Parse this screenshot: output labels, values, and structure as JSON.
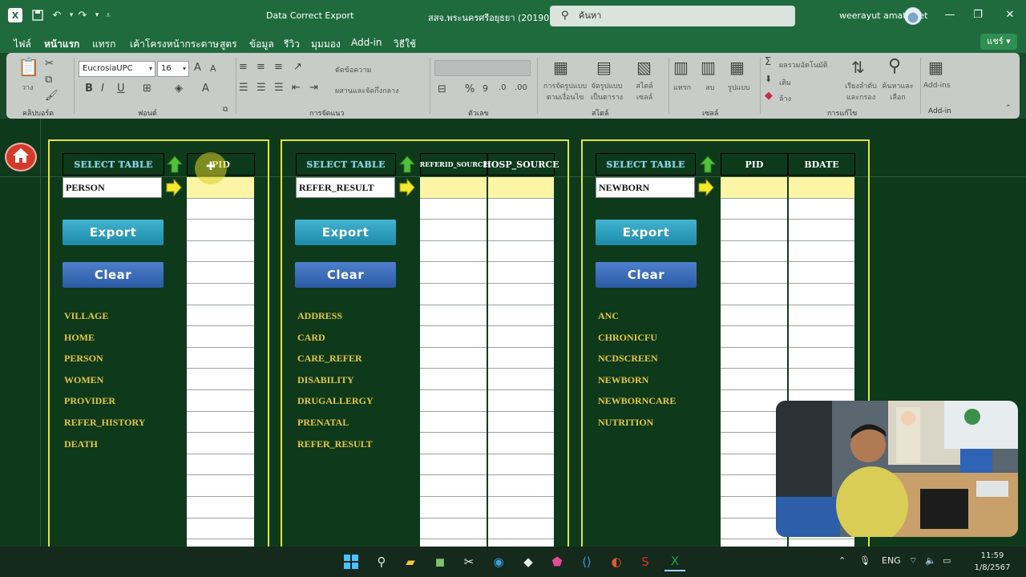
{
  "titlebar": {
    "app_title": "Data Correct Export",
    "file_title": "สสจ.พระนครศรีอยุธยา (20190...",
    "search_placeholder": "ค้นหา",
    "user_name": "weerayut amatawet"
  },
  "menu": [
    "ไฟล์",
    "หน้าแรก",
    "แทรก",
    "เค้าโครงหน้ากระดาษ",
    "สูตร",
    "ข้อมูล",
    "รีวิว",
    "มุมมอง",
    "Add-in",
    "วิธีใช้"
  ],
  "share_label": "แชร์",
  "ribbon": {
    "clipboard": {
      "paste_label": "วาง",
      "group_label": "คลิปบอร์ด"
    },
    "font": {
      "font_name": "EucrosiaUPC",
      "font_size": "16",
      "group_label": "ฟอนต์"
    },
    "alignment": {
      "wrap_label": "ตัดข้อความ",
      "merge_label": "ผสานและจัดกึ่งกลาง",
      "group_label": "การจัดแนว"
    },
    "number": {
      "group_label": "ตัวเลข"
    },
    "styles": {
      "conditional_label": "การจัดรูปแบบตามเงื่อนไข",
      "format_table_label": "จัดรูปแบบเป็นตาราง",
      "cell_styles_label": "สไตล์เซลล์",
      "group_label": "สไตล์"
    },
    "cells": {
      "insert_label": "แทรก",
      "delete_label": "ลบ",
      "format_label": "รูปแบบ",
      "group_label": "เซลล์"
    },
    "editing": {
      "autosum_label": "ผลรวมอัตโนมัติ",
      "fill_label": "เติม",
      "clear_label": "ล้าง",
      "sort_label": "เรียงลำดับและกรอง",
      "find_label": "ค้นหาและเลือก",
      "group_label": "การแก้ไข"
    },
    "addins": {
      "label": "Add-ins",
      "group_label": "Add-in"
    }
  },
  "panels": [
    {
      "select_header": "SELECT TABLE",
      "selected_table": "PERSON",
      "columns": [
        "PID"
      ],
      "export_label": "Export",
      "clear_label": "Clear",
      "tables": [
        "VILLAGE",
        "HOME",
        "PERSON",
        "WOMEN",
        "PROVIDER",
        "REFER_HISTORY",
        "DEATH"
      ]
    },
    {
      "select_header": "SELECT TABLE",
      "selected_table": "REFER_RESULT",
      "columns": [
        "REFERID_SOURCE",
        "HOSP_SOURCE"
      ],
      "export_label": "Export",
      "clear_label": "Clear",
      "tables": [
        "ADDRESS",
        "CARD",
        "CARE_REFER",
        "DISABILITY",
        "DRUGALLERGY",
        "PRENATAL",
        "REFER_RESULT"
      ]
    },
    {
      "select_header": "SELECT TABLE",
      "selected_table": "NEWBORN",
      "columns": [
        "PID",
        "BDATE"
      ],
      "export_label": "Export",
      "clear_label": "Clear",
      "tables": [
        "ANC",
        "CHRONICFU",
        "NCDSCREEN",
        "NEWBORN",
        "NEWBORNCARE",
        "NUTRITION"
      ]
    }
  ],
  "taskbar": {
    "lang": "ENG",
    "time": "11:59",
    "date": "1/8/2567"
  },
  "colors": {
    "sheet_bg": "#0e3a1b",
    "panel_border": "#e8e23a",
    "export_button": "#2aa3c4",
    "clear_button": "#3a6cba",
    "table_list_text": "#e6c64a",
    "highlight_cell": "#fcf5a5"
  }
}
